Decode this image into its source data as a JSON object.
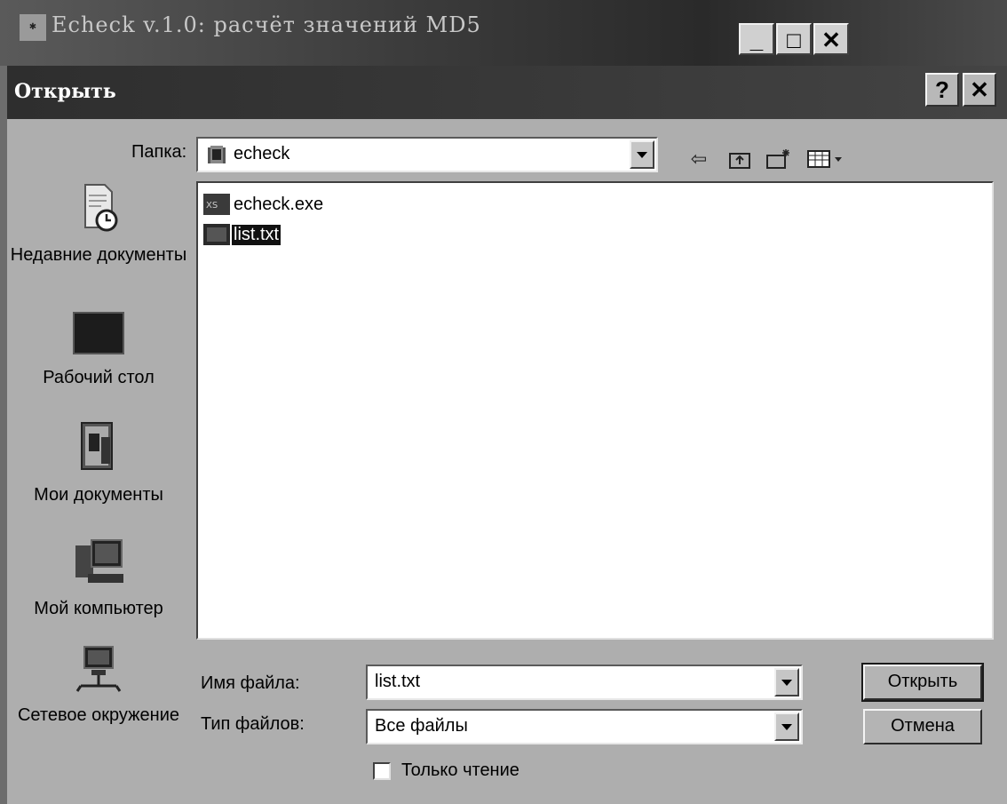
{
  "app": {
    "title": "Echeck v.1.0: расчёт значений MD5",
    "icon": "app-icon",
    "controls": {
      "minimize": "_",
      "maximize": "□",
      "close": "✕"
    }
  },
  "dialog": {
    "title": "Открыть",
    "help_label": "?",
    "close_label": "✕",
    "folder_label": "Папка:",
    "folder_value": "echeck",
    "toolbar_icons": [
      "back-icon",
      "up-folder-icon",
      "new-folder-icon",
      "view-menu-icon"
    ],
    "places": [
      {
        "label": "Недавние документы",
        "icon": "recent-documents-icon"
      },
      {
        "label": "Рабочий стол",
        "icon": "desktop-icon"
      },
      {
        "label": "Мои документы",
        "icon": "my-documents-icon"
      },
      {
        "label": "Мой компьютер",
        "icon": "my-computer-icon"
      },
      {
        "label": "Сетевое окружение",
        "icon": "network-icon"
      }
    ],
    "files": [
      {
        "name": "echeck.exe",
        "selected": false,
        "icon": "exe-file-icon"
      },
      {
        "name": "list.txt",
        "selected": true,
        "icon": "text-file-icon"
      }
    ],
    "filename_label": "Имя файла:",
    "filename_value": "list.txt",
    "filetype_label": "Тип файлов:",
    "filetype_value": "Все файлы",
    "readonly_label": "Только чтение",
    "readonly_checked": false,
    "open_button": "Открыть",
    "cancel_button": "Отмена"
  }
}
